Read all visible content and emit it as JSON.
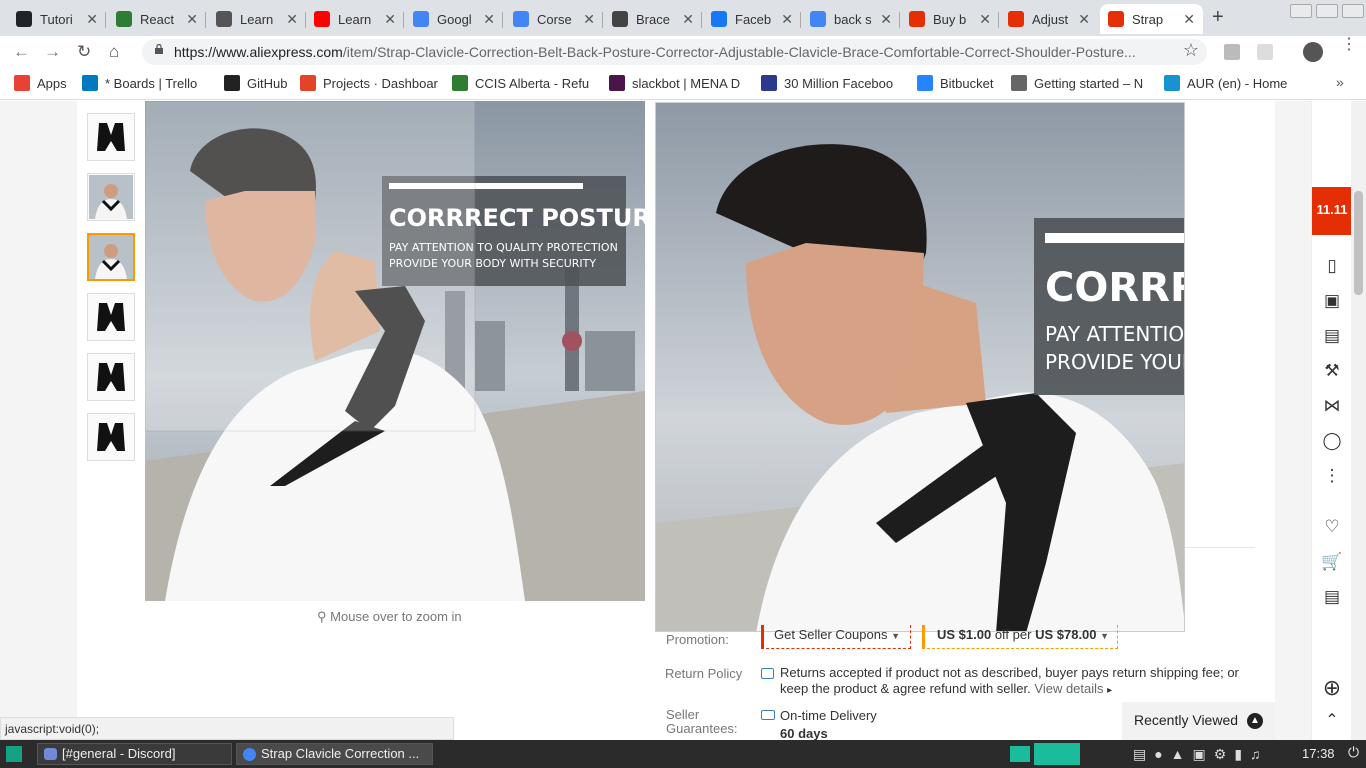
{
  "tabs": [
    {
      "title": "Tutori",
      "favicon_color": "#20232a"
    },
    {
      "title": "React",
      "favicon_color": "#2e7d32"
    },
    {
      "title": "Learn",
      "favicon_color": "#555555"
    },
    {
      "title": "Learn",
      "favicon_color": "#ff0000"
    },
    {
      "title": "Googl",
      "favicon_color": "#4285f4"
    },
    {
      "title": "Corse",
      "favicon_color": "#4285f4"
    },
    {
      "title": "Brace",
      "favicon_color": "#444444"
    },
    {
      "title": "Faceb",
      "favicon_color": "#1877f2"
    },
    {
      "title": "back s",
      "favicon_color": "#4285f4"
    },
    {
      "title": "Buy b",
      "favicon_color": "#e62e04"
    },
    {
      "title": "Adjust",
      "favicon_color": "#e62e04"
    },
    {
      "title": "Strap",
      "favicon_color": "#e62e04"
    }
  ],
  "address": {
    "url_host": "https://www.aliexpress.com",
    "url_path": "/item/Strap-Clavicle-Correction-Belt-Back-Posture-Corrector-Adjustable-Clavicle-Brace-Comfortable-Correct-Shoulder-Posture..."
  },
  "bookmarks": [
    {
      "label": "Apps"
    },
    {
      "label": "* Boards | Trello"
    },
    {
      "label": "GitHub"
    },
    {
      "label": "Projects · Dashboar"
    },
    {
      "label": "CCIS Alberta - Refu"
    },
    {
      "label": "slackbot | MENA D"
    },
    {
      "label": "30 Million Faceboo"
    },
    {
      "label": "Bitbucket"
    },
    {
      "label": "Getting started – N"
    },
    {
      "label": "AUR (en) - Home"
    }
  ],
  "product": {
    "banner_title": "CORRRECT POSTURE",
    "banner_line1": "PAY ATTENTION TO QUALITY PROTECTION",
    "banner_line2": "PROVIDE YOUR BODY WITH SECURITY",
    "zoom_title": "CORRREC",
    "zoom_line1": "PAY ATTENTION T",
    "zoom_line2": "PROVIDE YOUR BO",
    "zoom_tip": "Mouse over to zoom in",
    "promotion_label": "Promotion:",
    "coupon_label": "Get Seller Coupons",
    "discount_amount": "US $1.00",
    "discount_mid": "off per",
    "discount_threshold": "US $78.00",
    "return_label": "Return Policy",
    "return_text": "Returns accepted if product not as described, buyer pays return shipping fee; or keep the product & agree refund with seller.",
    "view_details": "View details",
    "guarantee_label": "Seller Guarantees:",
    "guarantee_text": "On-time Delivery",
    "guarantee_days": "60 days",
    "recently_viewed": "Recently Viewed"
  },
  "status_url": "javascript:void(0);",
  "taskbar": {
    "task1": "[#general - Discord]",
    "task2": "Strap Clavicle Correction ...",
    "clock": "17:38"
  }
}
